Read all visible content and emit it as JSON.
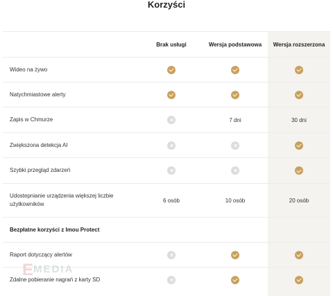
{
  "title": "Korzyści",
  "columns": [
    "Brak usługi",
    "Wersja podstawowa",
    "Wersja rozszerzona"
  ],
  "rows": [
    {
      "label": "Wideo na żywo",
      "values": [
        "check",
        "check",
        "check"
      ]
    },
    {
      "label": "Natychmiastowe alerty",
      "values": [
        "check",
        "check",
        "check"
      ]
    },
    {
      "label": "Zapis w Chmurze",
      "values": [
        "cross",
        "7 dni",
        "30 dni"
      ]
    },
    {
      "label": "Zwiększona detekcja AI",
      "values": [
        "cross",
        "cross",
        "check"
      ]
    },
    {
      "label": "Szybki przegląd zdarzeń",
      "values": [
        "cross",
        "cross",
        "check"
      ]
    },
    {
      "label": "Udostepnianie urządzenia większej liczbie użytkowników",
      "values": [
        "6 osób",
        "10 osób",
        "20 osób"
      ]
    }
  ],
  "section_title": "Bezpłatne korzyści z Imou Protect",
  "section_rows": [
    {
      "label": "Raport dotyczący alertów",
      "values": [
        "cross",
        "check",
        "check"
      ]
    },
    {
      "label": "Zdalne pobieranie nagrań z karty SD",
      "values": [
        "cross",
        "check",
        "check"
      ]
    }
  ],
  "watermark": "MEDIA",
  "colors": {
    "check": "#c9a15d",
    "cross": "#dcdcdc",
    "highlight_column": "#f5f3ef"
  }
}
